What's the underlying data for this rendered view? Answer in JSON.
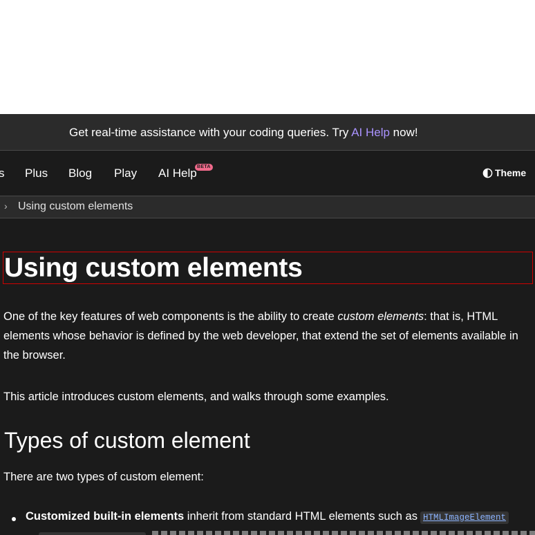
{
  "banner": {
    "prefix": "Get real-time assistance with your coding queries. Try ",
    "link": "AI Help",
    "suffix": " now!"
  },
  "nav": {
    "cut_item": "s",
    "items": [
      "Plus",
      "Blog",
      "Play",
      "AI Help"
    ],
    "beta_badge": "BETA",
    "theme_label": "Theme",
    "theme_icon": "contrast-half-circle-icon"
  },
  "breadcrumb": {
    "separator": "›",
    "current": "Using custom elements"
  },
  "article": {
    "title": "Using custom elements",
    "intro_1_a": "One of the key features of web components is the ability to create ",
    "intro_1_em": "custom elements",
    "intro_1_b": ": that is, HTML elements whose behavior is defined by the web developer, that extend the set of elements available in the browser.",
    "intro_2": "This article introduces custom elements, and walks through some examples.",
    "section_title": "Types of custom element",
    "section_intro": "There are two types of custom element:",
    "bullet_1_bold": "Customized built-in elements",
    "bullet_1_text": " inherit from standard HTML elements such as",
    "bullet_1_code": "HTMLImageElement"
  },
  "colors": {
    "background": "#1b1b1b",
    "banner_bg": "#2b2b2b",
    "ai_help_link": "#aa93ff",
    "beta_badge": "#f06a8b",
    "code_link": "#8cb4ff",
    "highlight_outline": "#d10000"
  }
}
